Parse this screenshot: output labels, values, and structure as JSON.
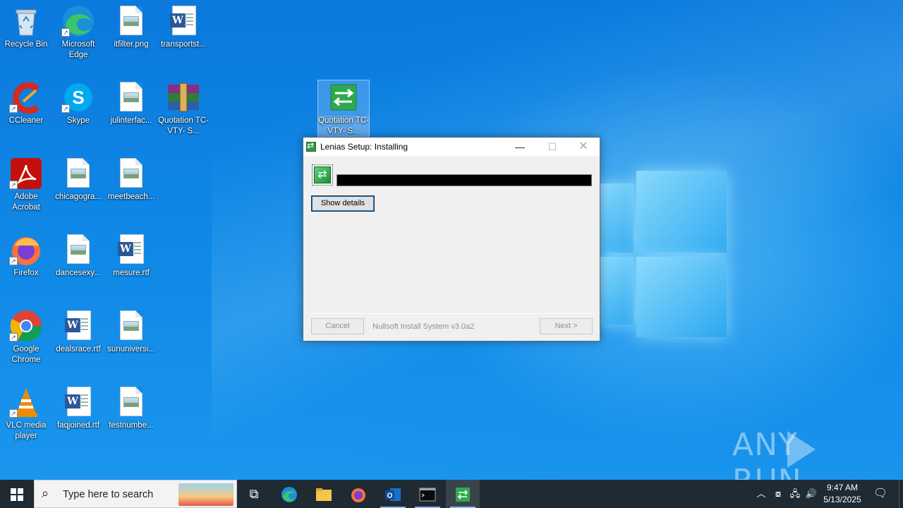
{
  "desktop_icons": [
    {
      "label": "Recycle Bin",
      "icon": "recycle-bin-icon"
    },
    {
      "label": "Microsoft Edge",
      "icon": "edge-icon"
    },
    {
      "label": "itfilter.png",
      "icon": "image-file-icon"
    },
    {
      "label": "transportst...",
      "icon": "word-doc-icon"
    },
    {
      "label": "CCleaner",
      "icon": "ccleaner-icon"
    },
    {
      "label": "Skype",
      "icon": "skype-icon"
    },
    {
      "label": "julinterfac...",
      "icon": "image-file-icon"
    },
    {
      "label": "Quotation TC-VTY- S...",
      "icon": "winrar-archive-icon"
    },
    {
      "label": "Adobe Acrobat",
      "icon": "acrobat-icon"
    },
    {
      "label": "chicagogra...",
      "icon": "image-file-icon"
    },
    {
      "label": "meetbeach...",
      "icon": "image-file-icon"
    },
    {
      "label": "Firefox",
      "icon": "firefox-icon"
    },
    {
      "label": "dancesexy...",
      "icon": "image-file-icon"
    },
    {
      "label": "mesure.rtf",
      "icon": "word-doc-icon"
    },
    {
      "label": "Google Chrome",
      "icon": "chrome-icon"
    },
    {
      "label": "dealsrace.rtf",
      "icon": "word-doc-icon"
    },
    {
      "label": "sununiversi...",
      "icon": "image-file-icon"
    },
    {
      "label": "VLC media player",
      "icon": "vlc-icon"
    },
    {
      "label": "faqjoined.rtf",
      "icon": "word-doc-icon"
    },
    {
      "label": "testnumbe...",
      "icon": "image-file-icon"
    },
    {
      "label": "Quotation TC-VTY- S...",
      "icon": "nsis-installer-icon"
    }
  ],
  "dialog": {
    "title": "Lenias Setup: Installing",
    "show_details_label": "Show details",
    "cancel_label": "Cancel",
    "footer_text": "Nullsoft Install System v3.0a2",
    "next_label": "Next >"
  },
  "watermark": {
    "text_left": "ANY",
    "text_right": "RUN"
  },
  "taskbar": {
    "search_placeholder": "Type here to search",
    "time": "9:47 AM",
    "date": "5/13/2025",
    "accent": "#8ab4f8"
  }
}
